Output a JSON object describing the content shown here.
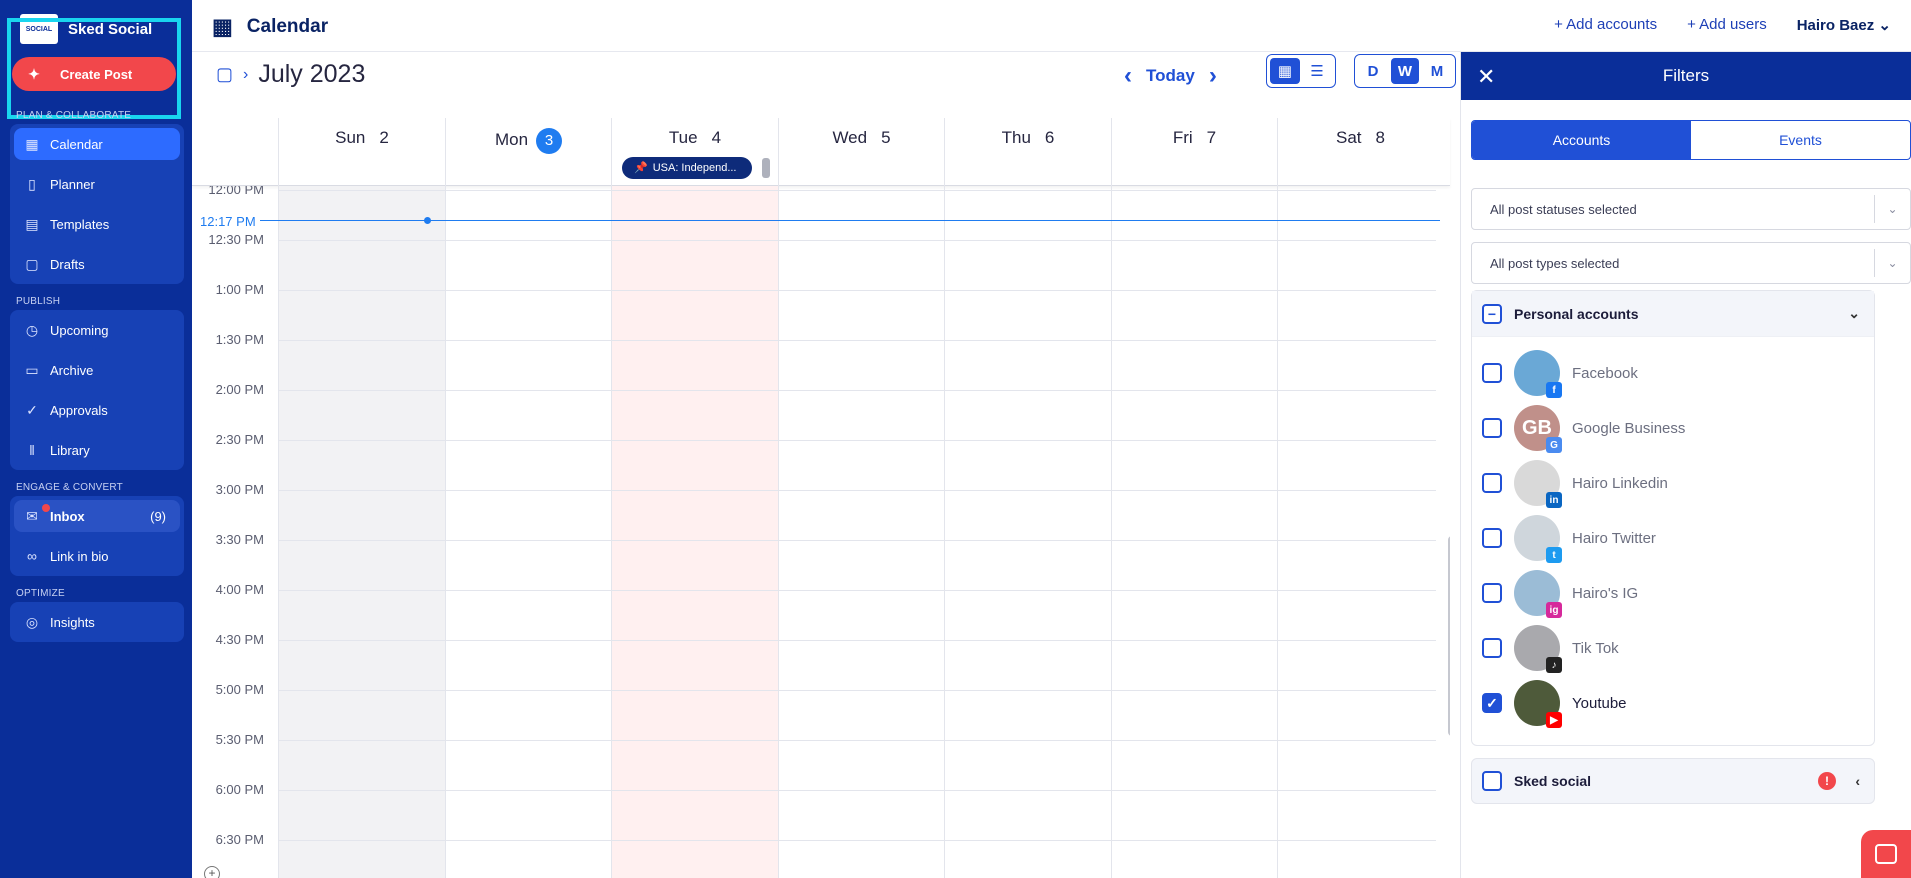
{
  "sidebar": {
    "brand": "Sked Social",
    "logo_text": "SOCIAL",
    "create_post": "Create Post",
    "sections": [
      {
        "label": "PLAN & COLLABORATE",
        "items": [
          "Calendar",
          "Planner",
          "Templates",
          "Drafts"
        ]
      },
      {
        "label": "PUBLISH",
        "items": [
          "Upcoming",
          "Archive",
          "Approvals",
          "Library"
        ]
      },
      {
        "label": "ENGAGE & CONVERT",
        "items": [
          "Inbox",
          "Link in bio"
        ]
      },
      {
        "label": "OPTIMIZE",
        "items": [
          "Insights"
        ]
      }
    ],
    "inbox_count": "(9)",
    "accent": "#0a2e99"
  },
  "topbar": {
    "title": "Calendar",
    "add_accounts": "+  Add accounts",
    "add_users": "+  Add users",
    "user": "Hairo Baez"
  },
  "calendar": {
    "month": "July 2023",
    "today": "Today",
    "views": [
      "D",
      "W",
      "M"
    ],
    "active_view": "W",
    "days": [
      {
        "name": "Sun",
        "num": "2"
      },
      {
        "name": "Mon",
        "num": "3"
      },
      {
        "name": "Tue",
        "num": "4"
      },
      {
        "name": "Wed",
        "num": "5"
      },
      {
        "name": "Thu",
        "num": "6"
      },
      {
        "name": "Fri",
        "num": "7"
      },
      {
        "name": "Sat",
        "num": "8"
      }
    ],
    "event": "USA: Independ...",
    "now_label": "12:17 PM",
    "times": [
      "12:00 PM",
      "12:30 PM",
      "1:00 PM",
      "1:30 PM",
      "2:00 PM",
      "2:30 PM",
      "3:00 PM",
      "3:30 PM",
      "4:00 PM",
      "4:30 PM",
      "5:00 PM",
      "5:30 PM",
      "6:00 PM",
      "6:30 PM"
    ]
  },
  "filters": {
    "title": "Filters",
    "tabs": [
      "Accounts",
      "Events"
    ],
    "status_select": "All post statuses selected",
    "type_select": "All post types selected",
    "group_personal": "Personal accounts",
    "accounts": [
      {
        "name": "Facebook",
        "checked": false,
        "initials": "",
        "badge": "f",
        "color": "#6aa8d6",
        "badge_color": "#1877f2"
      },
      {
        "name": "Google Business",
        "checked": false,
        "initials": "GB",
        "badge": "G",
        "color": "#c0908a",
        "badge_color": "#4a8bf0"
      },
      {
        "name": "Hairo Linkedin",
        "checked": false,
        "initials": "",
        "badge": "in",
        "color": "#d9d9d9",
        "badge_color": "#0a66c2"
      },
      {
        "name": "Hairo Twitter",
        "checked": false,
        "initials": "",
        "badge": "t",
        "color": "#cfd6dc",
        "badge_color": "#1d9bf0"
      },
      {
        "name": "Hairo's IG",
        "checked": false,
        "initials": "",
        "badge": "ig",
        "color": "#9bbcd6",
        "badge_color": "#d6299b"
      },
      {
        "name": "Tik Tok",
        "checked": false,
        "initials": "",
        "badge": "♪",
        "color": "#a9a9ad",
        "badge_color": "#222"
      },
      {
        "name": "Youtube",
        "checked": true,
        "initials": "",
        "badge": "▶",
        "color": "#4e5a3a",
        "badge_color": "#ff0000"
      }
    ],
    "group_sked": "Sked social"
  }
}
